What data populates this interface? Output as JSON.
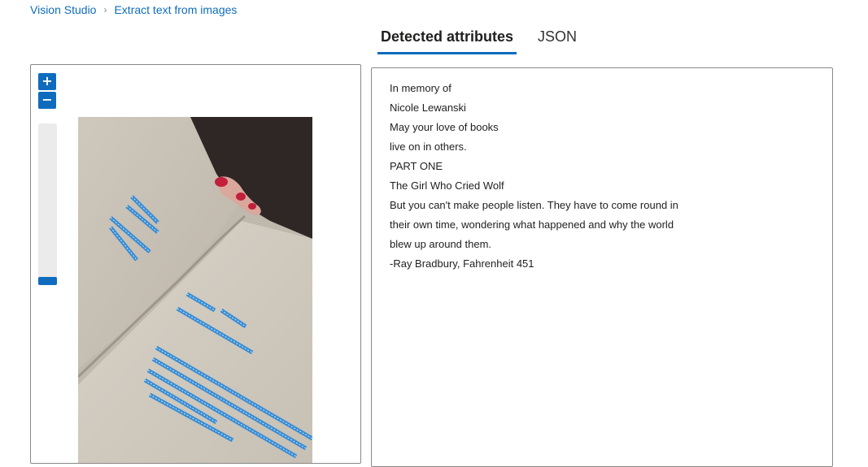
{
  "breadcrumb": {
    "home": "Vision Studio",
    "current": "Extract text from images"
  },
  "tabs": [
    {
      "label": "Detected attributes",
      "active": true
    },
    {
      "label": "JSON",
      "active": false
    }
  ],
  "zoom": {
    "in_label": "+",
    "out_label": "−"
  },
  "detected_lines": [
    "In memory of",
    "Nicole Lewanski",
    "May your love of books",
    "live on in others.",
    "PART ONE",
    "The Girl Who Cried Wolf",
    "But you can't make people listen. They have to come round in",
    "their own time, wondering what happened and why the world",
    "blew up around them.",
    "-Ray Bradbury, Fahrenheit 451"
  ],
  "colors": {
    "accent": "#0f6cbd",
    "highlight": "#2b88d8"
  },
  "icons": {
    "breadcrumb_separator": "chevron-right-icon"
  }
}
